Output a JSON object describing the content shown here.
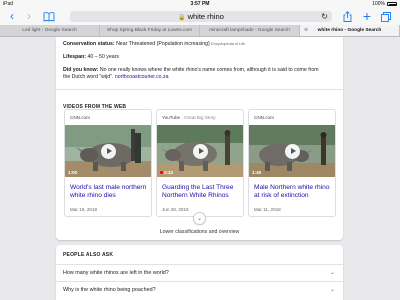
{
  "status_bar": {
    "device": "iPad",
    "time": "3:57 PM",
    "battery": "100%"
  },
  "browser": {
    "url_text": "white rhino",
    "tabs": [
      {
        "label": "Led light - Google Search",
        "active": false
      },
      {
        "label": "Shop Spring Black Friday at Lowes.com",
        "active": false
      },
      {
        "label": "minecraft lampshade - Google Search",
        "active": false
      },
      {
        "label": "white rhino - Google Search",
        "active": true
      }
    ],
    "tab_close_glyph": "⊗"
  },
  "facts": {
    "conservation_label": "Conservation status:",
    "conservation_value": "Near Threatened (Population increasing)",
    "conservation_source": "Encyclopedia of Life",
    "lifespan_label": "Lifespan:",
    "lifespan_value": "40 – 50 years",
    "dyk_label": "Did you know:",
    "dyk_text": "No one really knows where the white rhino's name comes from, although it is said to come from",
    "dyk_text2": "the Dutch word \"wijd\".",
    "dyk_link": "northcoastcourier.co.za"
  },
  "videos": {
    "heading": "VIDEOS FROM THE WEB",
    "items": [
      {
        "source": "CNN.com",
        "source_sub": "",
        "duration": "1:00",
        "title": "World's last male northern white rhino dies",
        "date": "Mar 19, 2018"
      },
      {
        "source": "YouTube",
        "source_sub": "· Great Big Story",
        "duration": "2:22",
        "title": "Guarding the Last Three Northern White Rhinos",
        "date": "Jun 28, 2016"
      },
      {
        "source": "CNN.com",
        "source_sub": "",
        "duration": "1:40",
        "title": "Male Northern white rhino at risk of extinction",
        "date": "Mar 11, 2018"
      }
    ],
    "expand_glyph": "⌄",
    "lower_label": "Lower classifications and overview"
  },
  "people_also_ask": {
    "heading": "PEOPLE ALSO ASK",
    "questions": [
      "How many white rhinos are left in the world?",
      "Why is the white rhino being poached?"
    ],
    "chevron": "⌄"
  },
  "colors": {
    "link": "#1a0dab",
    "ios_blue": "#1a7df0",
    "page_bg": "#e9e9ec"
  }
}
